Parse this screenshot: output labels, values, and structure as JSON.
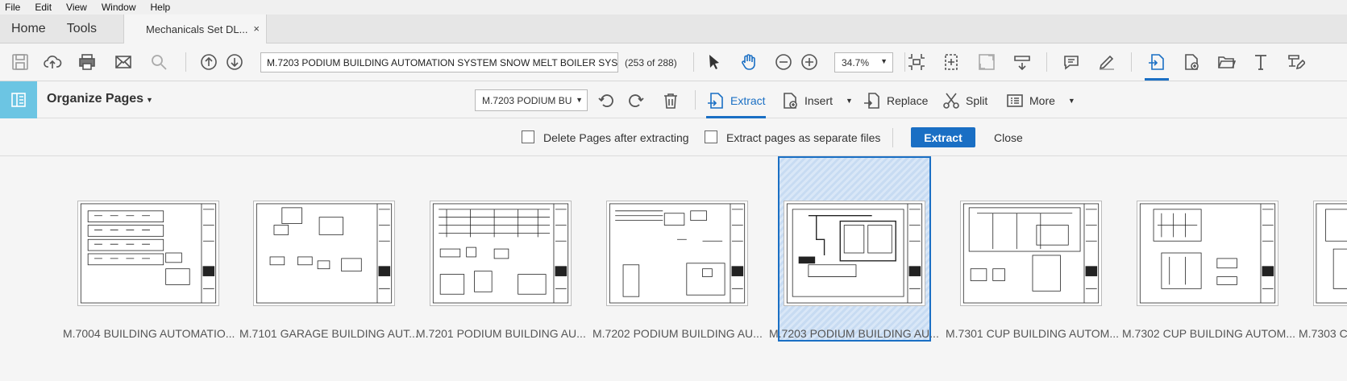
{
  "menu": [
    "File",
    "Edit",
    "View",
    "Window",
    "Help"
  ],
  "tabs": {
    "home": "Home",
    "tools": "Tools",
    "document": "Mechanicals Set DL...",
    "close_symbol": "×"
  },
  "toolbar": {
    "page_field": "M.7203 PODIUM BUILDING AUTOMATION SYSTEM SNOW MELT BOILER SYSTEM",
    "page_count": "(253 of 288)",
    "zoom": "34.7%"
  },
  "organize": {
    "title": "Organize Pages",
    "page_select": "M.7203 PODIUM BUI",
    "extract_label": "Extract",
    "insert_label": "Insert",
    "replace_label": "Replace",
    "split_label": "Split",
    "more_label": "More"
  },
  "extract_bar": {
    "delete_after": "Delete Pages after extracting",
    "separate_files": "Extract pages as separate files",
    "extract_button": "Extract",
    "close": "Close"
  },
  "pages": [
    {
      "label": "M.7004 BUILDING AUTOMATIO..."
    },
    {
      "label": "M.7101 GARAGE BUILDING AUT..."
    },
    {
      "label": "M.7201 PODIUM BUILDING AU..."
    },
    {
      "label": "M.7202 PODIUM BUILDING AU..."
    },
    {
      "label": "M.7203 PODIUM BUILDING AU...",
      "selected": true
    },
    {
      "label": "M.7301 CUP BUILDING AUTOM..."
    },
    {
      "label": "M.7302 CUP BUILDING AUTOM..."
    },
    {
      "label": "M.7303 C..."
    }
  ],
  "colors": {
    "accent": "#1a6fc4",
    "organize_icon_bg": "#6cc5e3"
  }
}
